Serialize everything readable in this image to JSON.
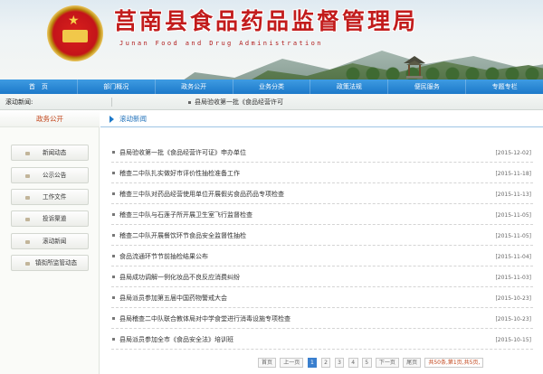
{
  "header": {
    "title": "莒南县食品药品监督管理局",
    "subtitle": "Junan Food and Drug Administration"
  },
  "nav": {
    "items": [
      "首　页",
      "部门概况",
      "政务公开",
      "业务分类",
      "政策法规",
      "便民服务",
      "专题专栏"
    ]
  },
  "ticker": {
    "label": "滚动新闻:",
    "text": "县局验收第一批《食品经营许可"
  },
  "sidebar": {
    "title": "政务公开",
    "items": [
      "新闻动态",
      "公示公告",
      "工作文件",
      "投诉渠道",
      "滚动新闻",
      "镇街所监管动态"
    ]
  },
  "main": {
    "section_title": "滚动新闻",
    "news": [
      {
        "title": "县局验收第一批《食品经营许可证》申办单位",
        "date": "[2015-12-02]"
      },
      {
        "title": "稽查二中队扎实做好市评价性抽检准备工作",
        "date": "[2015-11-18]"
      },
      {
        "title": "稽查三中队对药品经营使用单位开展假劣食品药品专项检查",
        "date": "[2015-11-13]"
      },
      {
        "title": "稽查三中队与石莲子所开展卫生室飞行监督检查",
        "date": "[2015-11-05]"
      },
      {
        "title": "稽查二中队开展餐饮环节食品安全监督性抽检",
        "date": "[2015-11-05]"
      },
      {
        "title": "食品流通环节节前抽检结果公布",
        "date": "[2015-11-04]"
      },
      {
        "title": "县局成功调解一例化妆品不良反应消费纠纷",
        "date": "[2015-11-03]"
      },
      {
        "title": "县局派员参加第五届中国药物警戒大会",
        "date": "[2015-10-23]"
      },
      {
        "title": "县局稽查二中队联合教体局对中学食堂进行消毒设施专项检查",
        "date": "[2015-10-23]"
      },
      {
        "title": "县局派员参加全市《食品安全法》培训班",
        "date": "[2015-10-15]"
      }
    ],
    "pager": {
      "first": "首页",
      "prev": "上一页",
      "pages": [
        "1",
        "2",
        "3",
        "4",
        "5"
      ],
      "current": "1",
      "next": "下一页",
      "last": "尾页",
      "info": "共50条,第1页,共5页,"
    }
  },
  "colors": {
    "nav_blue": "#1d79c9",
    "title_red": "#c21c1c",
    "accent_orange": "#c2451b"
  }
}
